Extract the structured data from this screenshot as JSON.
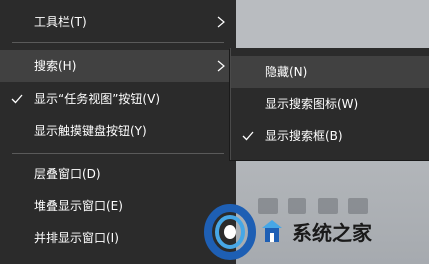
{
  "main_menu": {
    "items": [
      {
        "label": "工具栏(T)",
        "has_submenu": true,
        "checked": false,
        "highlighted": false
      },
      {
        "label": "搜索(H)",
        "has_submenu": true,
        "checked": false,
        "highlighted": true
      },
      {
        "label": "显示“任务视图”按钮(V)",
        "has_submenu": false,
        "checked": true,
        "highlighted": false
      },
      {
        "label": "显示触摸键盘按钮(Y)",
        "has_submenu": false,
        "checked": false,
        "highlighted": false
      },
      {
        "label": "层叠窗口(D)",
        "has_submenu": false,
        "checked": false,
        "highlighted": false
      },
      {
        "label": "堆叠显示窗口(E)",
        "has_submenu": false,
        "checked": false,
        "highlighted": false
      },
      {
        "label": "并排显示窗口(I)",
        "has_submenu": false,
        "checked": false,
        "highlighted": false
      }
    ]
  },
  "search_submenu": {
    "items": [
      {
        "label": "隐藏(N)",
        "checked": false,
        "highlighted": true
      },
      {
        "label": "显示搜索图标(W)",
        "checked": false,
        "highlighted": false
      },
      {
        "label": "显示搜索框(B)",
        "checked": true,
        "highlighted": false
      }
    ]
  },
  "watermark": {
    "text": "系统之家",
    "icon": "system-home-logo-icon"
  },
  "colors": {
    "menu_background": "#2b2b2b",
    "menu_highlight": "#414141",
    "menu_text": "#ffffff",
    "separator": "#5a5a5a",
    "logo_blue": "#1e5fb4",
    "logo_light_blue": "#47a7e6"
  }
}
